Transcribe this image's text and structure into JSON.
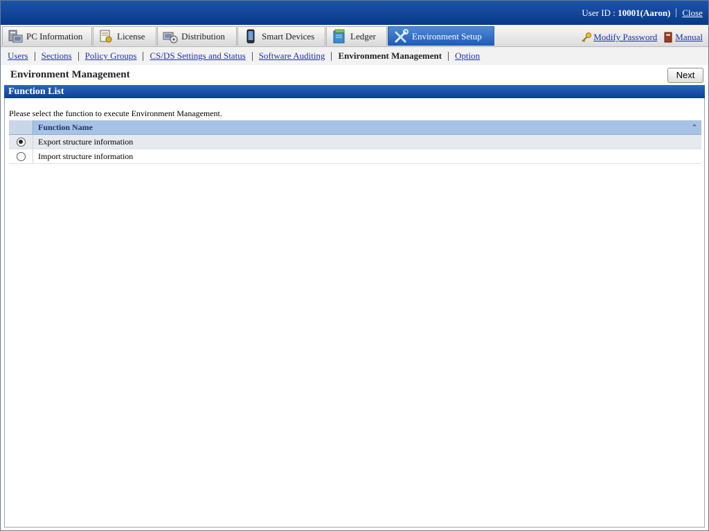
{
  "header": {
    "user_id_label": "User ID : ",
    "user_id_value": "10001(Aaron)",
    "close_label": "Close"
  },
  "tabs": [
    {
      "label": "PC Information",
      "icon": "pc-information-icon"
    },
    {
      "label": "License",
      "icon": "license-icon"
    },
    {
      "label": "Distribution",
      "icon": "distribution-icon"
    },
    {
      "label": "Smart Devices",
      "icon": "smart-device-icon"
    },
    {
      "label": "Ledger",
      "icon": "ledger-icon"
    },
    {
      "label": "Environment Setup",
      "icon": "tools-icon",
      "active": true
    }
  ],
  "header_links": {
    "modify_password": "Modify Password",
    "manual": "Manual"
  },
  "submenu": [
    {
      "label": "Users",
      "link": true
    },
    {
      "label": "Sections",
      "link": true
    },
    {
      "label": "Policy Groups",
      "link": true
    },
    {
      "label": "CS/DS Settings and Status",
      "link": true
    },
    {
      "label": "Software Auditing",
      "link": true
    },
    {
      "label": "Environment Management",
      "link": false
    },
    {
      "label": "Option",
      "link": true
    }
  ],
  "page": {
    "title": "Environment Management",
    "next_label": "Next",
    "section_title": "Function List",
    "instruction": "Please select the function to execute Environment Management."
  },
  "table": {
    "header": "Function Name",
    "rows": [
      {
        "label": "Export structure information",
        "selected": true
      },
      {
        "label": "Import structure information",
        "selected": false
      }
    ]
  },
  "colors": {
    "topbar": "#0b3f94",
    "active_tab": "#1d5bb6",
    "link": "#1a33aa",
    "table_header": "#a8c2e6"
  }
}
